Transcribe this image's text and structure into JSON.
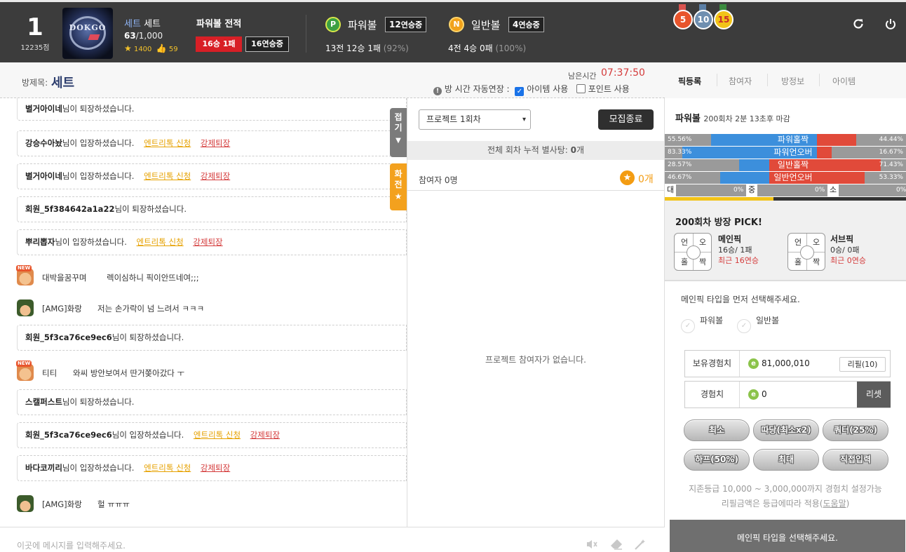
{
  "header": {
    "rank": "1",
    "points": "12235점",
    "avatar_text": "DOKGO",
    "user_name": "세트",
    "user_tag": "세트",
    "member_current": "63",
    "member_max": "/1,000",
    "stars": "1400",
    "likes": "59",
    "record_title": "파워볼 전적",
    "record_winloss": "16승 1패",
    "record_streak": "16연승중",
    "powerball_label": "파워볼",
    "powerball_streak_num": "12",
    "powerball_streak_text": "연승중",
    "powerball_record": "13전 12승 1패",
    "powerball_pct": "(92%)",
    "normal_label": "일반볼",
    "normal_streak_num": "4",
    "normal_streak_text": "연승중",
    "normal_record": "4전 4승 0패",
    "normal_pct": "(100%)",
    "medals": [
      "5",
      "10",
      "15"
    ],
    "icons": [
      "refresh-icon",
      "power-icon"
    ]
  },
  "room": {
    "title_label": "방제목:",
    "title": "세트",
    "remain_label": "남은시간",
    "remain_time": "07:37:50",
    "auto_ext_label": "방 시간 자동연장 :",
    "item_use": "아이템 사용",
    "item_use_checked": true,
    "point_use": "포인트 사용",
    "point_use_checked": false
  },
  "right_tabs": [
    "픽등록",
    "참여자",
    "방정보",
    "아이템"
  ],
  "chat": {
    "fold_label": "접기",
    "fav_label": "화전",
    "input_placeholder": "이곳에 메시지를 입력해주세요.",
    "entry_link": "엔트리톡 신청",
    "kick_link": "강제퇴장",
    "system": [
      {
        "nick": "별거아이네",
        "text": "님이 퇴장하셨습니다.",
        "links": false
      },
      {
        "nick": "강승수아놨",
        "text": "님이 입장하셨습니다.",
        "links": true
      },
      {
        "nick": "별거아이네",
        "text": "님이 입장하셨습니다.",
        "links": true
      },
      {
        "nick": "회원_5f384642a1a22",
        "text": "님이 퇴장하셨습니다.",
        "links": false
      },
      {
        "nick": "뿌리뽑자",
        "text": "님이 입장하셨습니다.",
        "links": true
      },
      {
        "nick": "회원_5f3ca76ce9ec6",
        "text": "님이 퇴장하셨습니다.",
        "links": false
      },
      {
        "nick": "스캘퍼스트",
        "text": "님이 퇴장하셨습니다.",
        "links": false
      },
      {
        "nick": "회원_5f3ca76ce9ec6",
        "text": "님이 입장하셨습니다.",
        "links": true
      },
      {
        "nick": "바다코끼리",
        "text": "님이 입장하셨습니다.",
        "links": true
      }
    ],
    "users": [
      {
        "name": "대박을꿈꾸며",
        "text": "렉이심하니 픽이안뜨네여;;;",
        "new": true
      },
      {
        "name": "[AMG]화랑",
        "text": "저는 손가락이 넘 느려서 ㅋㅋㅋ",
        "new": false
      },
      {
        "name": "티티",
        "text": "와씨 방안보여서 딴거쫒아갔다 ㅜ",
        "new": true
      },
      {
        "name": "[AMG]화랑",
        "text": "헐 ㅠㅠㅠ",
        "new": false
      }
    ],
    "new_badge": "NEW"
  },
  "project": {
    "select_value": "프로젝트 1회차",
    "close_button": "모집종료",
    "cumulative_prefix": "전체 회차 누적 별사탕:",
    "cumulative_value": "0",
    "cumulative_suffix": "개",
    "participants": "참여자 0명",
    "star_count": "0개",
    "empty_message": "프로젝트 참여자가 없습니다."
  },
  "pick": {
    "round_title": "파워볼",
    "round_sub": "200회차 2분 13초후 마감",
    "stats": [
      {
        "label": "파워홀짝",
        "left_pct": 55.56,
        "right_pct": 44.44,
        "left_text": "55.56%",
        "right_text": "44.44%",
        "style": "blue"
      },
      {
        "label": "파워언오버",
        "left_pct": 83.33,
        "right_pct": 16.67,
        "left_text": "83.33%",
        "right_text": "16.67%",
        "style": "blue"
      },
      {
        "label": "일반홀짝",
        "left_pct": 28.57,
        "right_pct": 71.43,
        "left_text": "28.57%",
        "right_text": "71.43%",
        "style": "red"
      },
      {
        "label": "일반언오버",
        "left_pct": 46.67,
        "right_pct": 53.33,
        "left_text": "46.67%",
        "right_text": "53.33%",
        "style": "red"
      }
    ],
    "sizes": [
      {
        "key": "대",
        "pct": "0%"
      },
      {
        "key": "중",
        "pct": "0%"
      },
      {
        "key": "소",
        "pct": "0%"
      }
    ],
    "progress": 0.45,
    "box_title": "200회차 방장 PICK!",
    "grid_labels": [
      "언",
      "오",
      "홀",
      "짝"
    ],
    "main": {
      "title": "메인픽",
      "record": "16승/ 1패",
      "recent": "최근 16연승"
    },
    "sub": {
      "title": "서브픽",
      "record": "0승/ 0패",
      "recent": "최근 0연승"
    },
    "guide": "메인픽 타입을 먼저 선택해주세요.",
    "options": [
      "파워볼",
      "일반볼"
    ],
    "exp_label": "보유경험치",
    "exp_value": "81,000,010",
    "refill_button": "리필(10)",
    "bet_label": "경험치",
    "bet_value": "0",
    "reset_button": "리셋",
    "amount_buttons": [
      "최소",
      "따당(최소x2)",
      "쿼터(25%)",
      "하프(50%)",
      "최대",
      "직접입력"
    ],
    "note1": "지존등급 10,000 ~ 3,000,000까지 경험치 설정가능",
    "note2_prefix": "리필금액은 등급에따라 적용(",
    "note2_link": "도움말",
    "note2_suffix": ")",
    "bottom_message": "메인픽 타입을 선택해주세요."
  }
}
